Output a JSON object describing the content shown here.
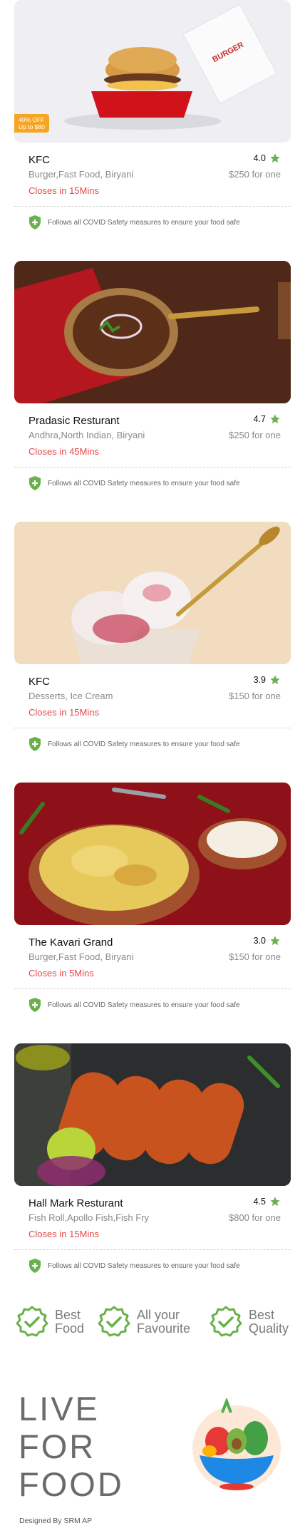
{
  "restaurants": [
    {
      "name": "KFC",
      "rating": "4.0",
      "cuisine": "Burger,Fast Food, Biryani",
      "price": "$250 for one",
      "closes": "Closes in 15Mins",
      "offer_line1": "40% OFF",
      "offer_line2": "Up to $80",
      "safety": "Follows all COVID Safety measures to ensure your food safe",
      "image": "burger-box-photo"
    },
    {
      "name": "Pradasic Resturant",
      "rating": "4.7",
      "cuisine": "Andhra,North Indian, Biryani",
      "price": "$250 for one",
      "closes": "Closes in 45Mins",
      "safety": "Follows all COVID Safety measures to ensure your food safe",
      "image": "curry-pan-photo"
    },
    {
      "name": "KFC",
      "rating": "3.9",
      "cuisine": "Desserts, Ice Cream",
      "price": "$150 for one",
      "closes": "Closes in 15Mins",
      "safety": "Follows all COVID Safety measures to ensure your food safe",
      "image": "ice-cream-photo"
    },
    {
      "name": "The Kavari Grand",
      "rating": "3.0",
      "cuisine": "Burger,Fast Food, Biryani",
      "price": "$150 for one",
      "closes": "Closes in 5Mins",
      "safety": "Follows all COVID Safety measures to ensure your food safe",
      "image": "biryani-pot-photo"
    },
    {
      "name": "Hall Mark Resturant",
      "rating": "4.5",
      "cuisine": "Fish Roll,Apollo Fish,Fish Fry",
      "price": "$800 for one",
      "closes": "Closes in 15Mins",
      "safety": "Follows all COVID Safety measures to ensure your food safe",
      "image": "kebab-platter-photo"
    }
  ],
  "features": [
    {
      "line1": "Best",
      "line2": "Food",
      "icon": "check-badge-icon"
    },
    {
      "line1": "All your",
      "line2": "Favourite",
      "icon": "check-badge-icon"
    },
    {
      "line1": "Best",
      "line2": "Quality",
      "icon": "check-badge-icon"
    }
  ],
  "tagline": [
    "LIVE",
    "FOR",
    "FOOD"
  ],
  "footer": "Designed By SRM AP",
  "colors": {
    "star": "#6ab04c",
    "closes": "#e8474a",
    "offer": "#f6a623",
    "shield": "#6ab04c",
    "muted": "#8a8a8a"
  }
}
